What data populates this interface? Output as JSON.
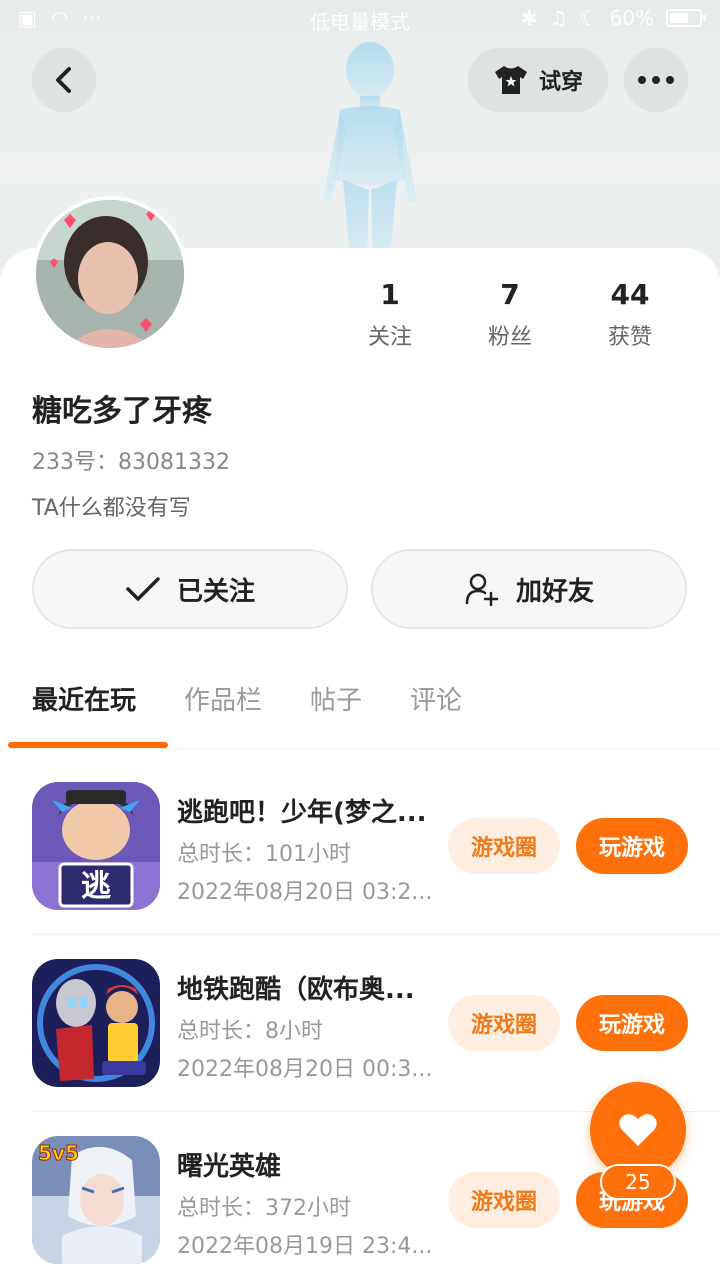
{
  "status_bar": {
    "center_text": "低电量模式",
    "battery": "60%"
  },
  "header": {
    "try_on_label": "试穿"
  },
  "profile": {
    "stats": [
      {
        "value": "1",
        "label": "关注"
      },
      {
        "value": "7",
        "label": "粉丝"
      },
      {
        "value": "44",
        "label": "获赞"
      }
    ],
    "name": "糖吃多了牙疼",
    "id_text": "233号：83081332",
    "bio": "TA什么都没有写",
    "follow_label": "已关注",
    "add_friend_label": "加好友"
  },
  "tabs": [
    "最近在玩",
    "作品栏",
    "帖子",
    "评论"
  ],
  "games": [
    {
      "title": "逃跑吧！少年(梦之...",
      "duration": "总时长：101小时",
      "date": "2022年08月20日 03:2...",
      "circle_label": "游戏圈",
      "play_label": "玩游戏",
      "icon_text": "逃"
    },
    {
      "title": "地铁跑酷（欧布奥...",
      "duration": "总时长：8小时",
      "date": "2022年08月20日 00:3...",
      "circle_label": "游戏圈",
      "play_label": "玩游戏"
    },
    {
      "title": "曙光英雄",
      "duration": "总时长：372小时",
      "date": "2022年08月19日 23:4...",
      "circle_label": "游戏圈",
      "play_label": "玩游戏",
      "icon_text": "5v5"
    }
  ],
  "like": {
    "count": "25"
  },
  "colors": {
    "accent": "#ff6f0a",
    "circle_bg": "#fdeee1"
  }
}
